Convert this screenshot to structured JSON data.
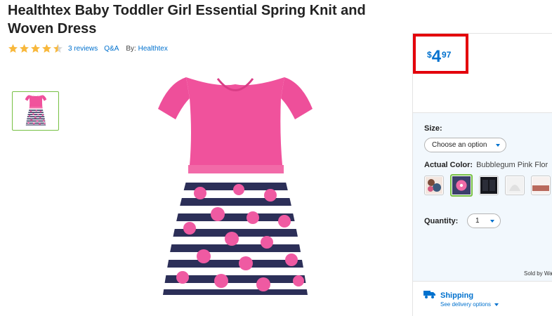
{
  "product": {
    "title": "Healthtex Baby Toddler Girl Essential Spring Knit and Woven Dress",
    "rating": 4.5,
    "rating_max": 5,
    "reviews_label": "3 reviews",
    "qa_label": "Q&A",
    "by_label": "By:",
    "brand": "Healthtex"
  },
  "price": {
    "currency": "$",
    "dollars": "4",
    "cents": "97"
  },
  "options": {
    "size_label": "Size:",
    "size_placeholder": "Choose an option",
    "color_label": "Actual Color:",
    "color_value": "Bubblegum Pink Flor",
    "swatches": [
      "floral-multi",
      "bubblegum-pink-floral",
      "black",
      "white-floral",
      "pink-stripe"
    ],
    "selected_swatch": 1,
    "quantity_label": "Quantity:",
    "quantity_value": "1",
    "sold_by": "Sold by Wa"
  },
  "shipping": {
    "title": "Shipping",
    "link": "See delivery options"
  },
  "colors": {
    "accent": "#0071ce",
    "star": "#f8b83c",
    "highlight": "#e3000b",
    "selected": "#76c043"
  }
}
